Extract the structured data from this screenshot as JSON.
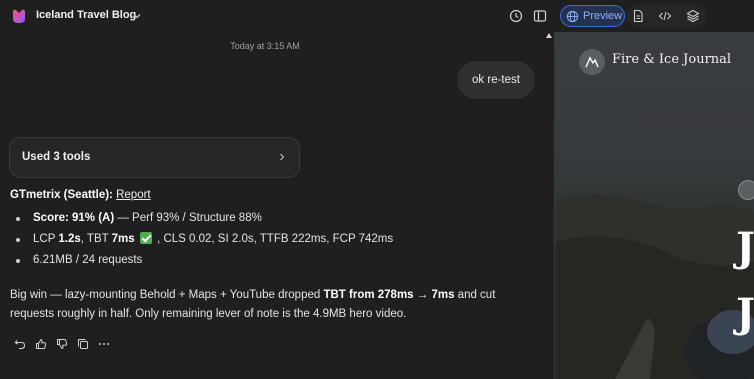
{
  "app": {
    "title": "Iceland Travel Blog",
    "preview_label": "Preview",
    "accent_color": "#3d6fd6"
  },
  "header_icons": [
    "logo-icon",
    "chevron-down-icon",
    "history-icon",
    "sidebar-icon",
    "globe-icon",
    "file-icon",
    "code-icon",
    "layers-icon"
  ],
  "chat": {
    "timestamp": "Today at 3:15 AM",
    "user_message": "ok re-test",
    "tools_label": "Used 3 tools",
    "assistant": {
      "heading_prefix": "GTmetrix (Seattle):",
      "heading_link": "Report",
      "bullet1": {
        "bold": "Score: 91% (A)",
        "rest": " — Perf 93% / Structure 88%"
      },
      "bullet2": {
        "t1": "LCP ",
        "b1": "1.2s",
        "t2": ", TBT ",
        "b2": "7ms",
        "t3": " , CLS 0.02, SI 2.0s, TTFB 222ms, FCP 742ms"
      },
      "bullet3": "6.21MB / 24 requests",
      "para_line1": {
        "t1": "Big win — lazy-mounting Behold + Maps + YouTube dropped ",
        "b1": "TBT from 278ms → 7ms",
        "t2": " and cut"
      },
      "para_line2": "requests roughly in half. Only remaining lever of note is the 4.9MB hero video."
    },
    "action_icons": [
      "undo-icon",
      "thumbs-up-icon",
      "thumbs-down-icon",
      "copy-icon",
      "more-icon"
    ]
  },
  "preview": {
    "site_name": "Fire & Ice Journal",
    "hero_chars": [
      "J",
      "J"
    ]
  }
}
